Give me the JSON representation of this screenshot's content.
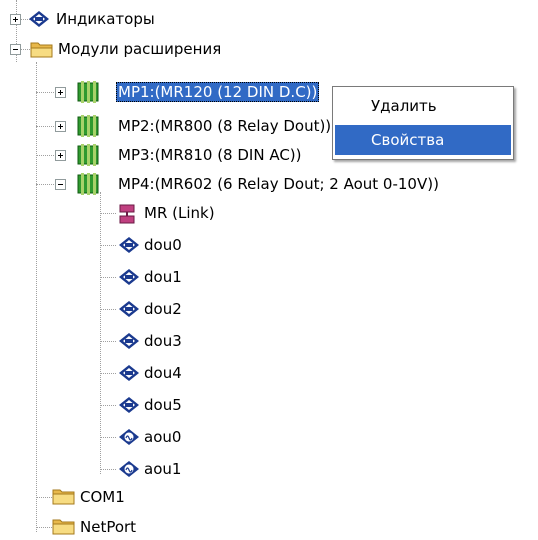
{
  "tree": {
    "indicators": "Индикаторы",
    "expansion_modules": "Модули расширения",
    "mp1": "MP1:(MR120 (12 DIN D.C))",
    "mp2": "MP2:(MR800 (8 Relay Dout))",
    "mp3": "MP3:(MR810 (8 DIN AC))",
    "mp4": "MP4:(MR602 (6 Relay Dout; 2 Aout 0-10V))",
    "mp4_children": [
      "MR (Link)",
      "dou0",
      "dou1",
      "dou2",
      "dou3",
      "dou4",
      "dou5",
      "aou0",
      "aou1"
    ],
    "com1": "COM1",
    "netport": "NetPort"
  },
  "context_menu": {
    "delete": "Удалить",
    "properties": "Свойства"
  },
  "colors": {
    "selection": "#316ac5",
    "folder": "#f3d46e",
    "module": "#2f9a2f",
    "node": "#1b3a8f"
  }
}
